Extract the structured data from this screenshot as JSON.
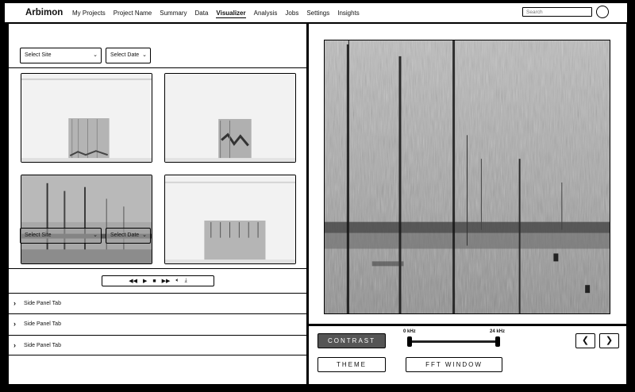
{
  "app": {
    "brand": "Arbimon"
  },
  "nav": {
    "items": [
      "My Projects",
      "Project Name",
      "Summary",
      "Data",
      "Visualizer",
      "Analysis",
      "Jobs",
      "Settings",
      "Insights"
    ],
    "active": "Visualizer"
  },
  "search": {
    "placeholder": "Search"
  },
  "filters": {
    "site_label": "Select Site",
    "date_label": "Select Date"
  },
  "player": {
    "icons": [
      "rewind-icon",
      "play-icon",
      "stop-icon",
      "fast-forward-icon",
      "volume-icon",
      "download-icon"
    ]
  },
  "side_tabs": [
    "Side Panel Tab",
    "Side Panel Tab",
    "Side Panel Tab"
  ],
  "controls": {
    "contrast_label": "CONTRAST",
    "theme_label": "THEME",
    "fft_label": "FFT WINDOW",
    "freq_min": "0 kHz",
    "freq_max": "24 kHz",
    "prev_label": "❮",
    "next_label": "❯"
  }
}
